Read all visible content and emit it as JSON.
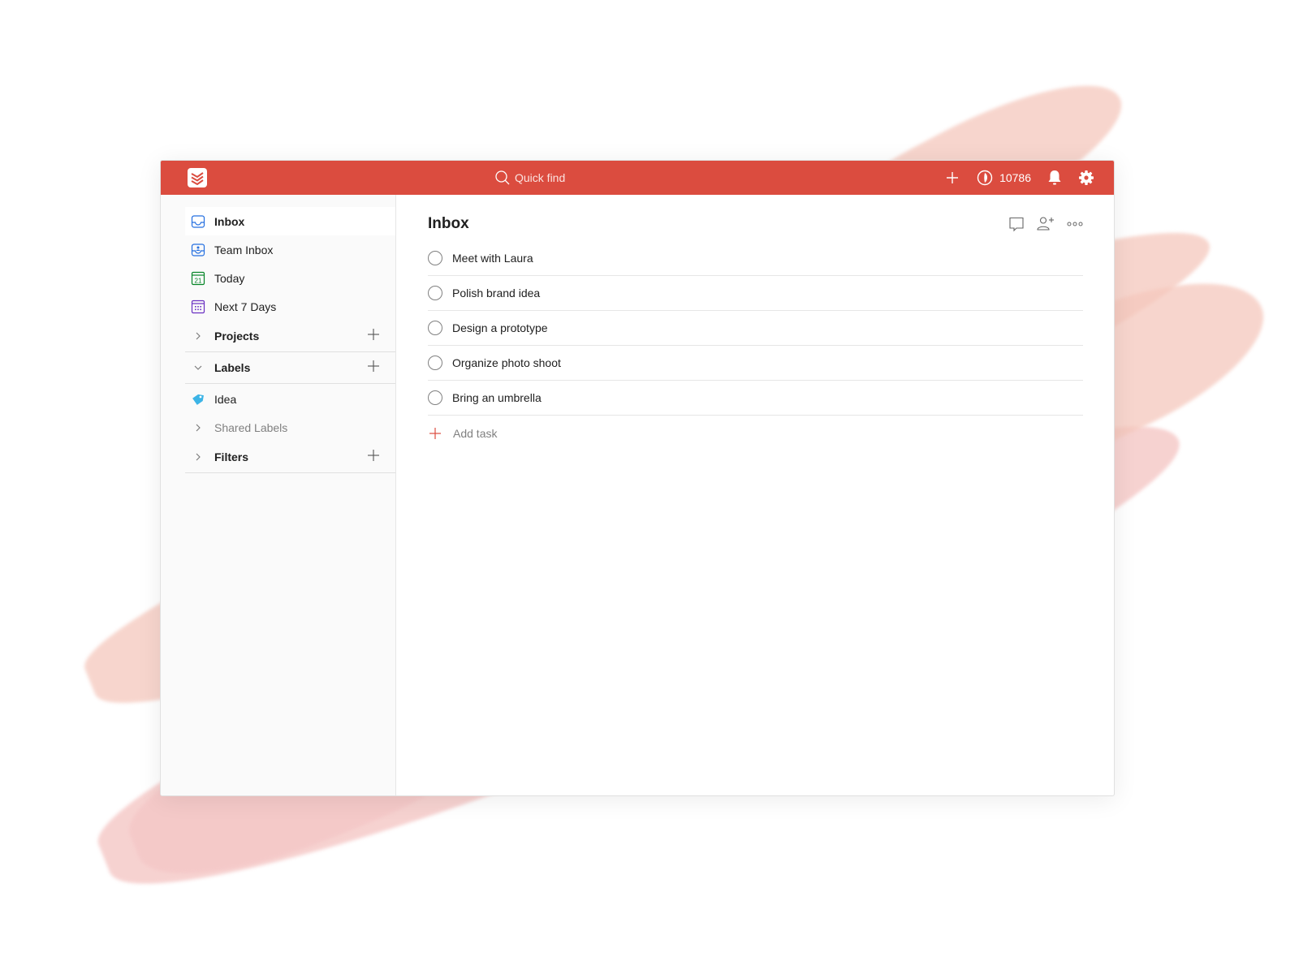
{
  "topbar": {
    "search_placeholder": "Quick find",
    "karma_count": "10786",
    "accent_color": "#db4c3f"
  },
  "sidebar": {
    "nav": [
      {
        "label": "Inbox",
        "icon": "inbox-icon",
        "active": true
      },
      {
        "label": "Team Inbox",
        "icon": "team-inbox-icon"
      },
      {
        "label": "Today",
        "icon": "calendar-today-icon",
        "day": "21"
      },
      {
        "label": "Next 7 Days",
        "icon": "calendar-week-icon"
      }
    ],
    "sections": {
      "projects": "Projects",
      "labels": "Labels",
      "filters": "Filters"
    },
    "labels": [
      {
        "label": "Idea",
        "icon": "label-tag-icon",
        "color": "#3cb4e6"
      }
    ],
    "shared_labels": "Shared Labels"
  },
  "main": {
    "title": "Inbox",
    "tasks": [
      "Meet with Laura",
      "Polish brand idea",
      "Design a prototype",
      "Organize photo shoot",
      "Bring an umbrella"
    ],
    "add_task_label": "Add task"
  }
}
